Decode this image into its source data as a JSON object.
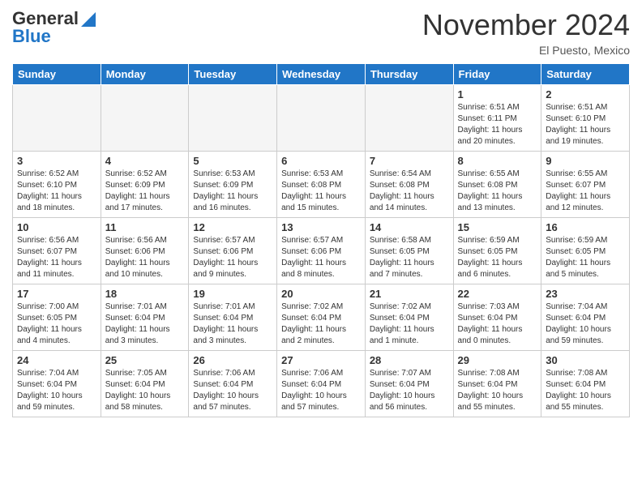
{
  "header": {
    "logo_general": "General",
    "logo_blue": "Blue",
    "month_title": "November 2024",
    "location": "El Puesto, Mexico"
  },
  "weekdays": [
    "Sunday",
    "Monday",
    "Tuesday",
    "Wednesday",
    "Thursday",
    "Friday",
    "Saturday"
  ],
  "rows": [
    [
      {
        "day": "",
        "info": "",
        "empty": true
      },
      {
        "day": "",
        "info": "",
        "empty": true
      },
      {
        "day": "",
        "info": "",
        "empty": true
      },
      {
        "day": "",
        "info": "",
        "empty": true
      },
      {
        "day": "",
        "info": "",
        "empty": true
      },
      {
        "day": "1",
        "info": "Sunrise: 6:51 AM\nSunset: 6:11 PM\nDaylight: 11 hours\nand 20 minutes.",
        "empty": false
      },
      {
        "day": "2",
        "info": "Sunrise: 6:51 AM\nSunset: 6:10 PM\nDaylight: 11 hours\nand 19 minutes.",
        "empty": false
      }
    ],
    [
      {
        "day": "3",
        "info": "Sunrise: 6:52 AM\nSunset: 6:10 PM\nDaylight: 11 hours\nand 18 minutes.",
        "empty": false
      },
      {
        "day": "4",
        "info": "Sunrise: 6:52 AM\nSunset: 6:09 PM\nDaylight: 11 hours\nand 17 minutes.",
        "empty": false
      },
      {
        "day": "5",
        "info": "Sunrise: 6:53 AM\nSunset: 6:09 PM\nDaylight: 11 hours\nand 16 minutes.",
        "empty": false
      },
      {
        "day": "6",
        "info": "Sunrise: 6:53 AM\nSunset: 6:08 PM\nDaylight: 11 hours\nand 15 minutes.",
        "empty": false
      },
      {
        "day": "7",
        "info": "Sunrise: 6:54 AM\nSunset: 6:08 PM\nDaylight: 11 hours\nand 14 minutes.",
        "empty": false
      },
      {
        "day": "8",
        "info": "Sunrise: 6:55 AM\nSunset: 6:08 PM\nDaylight: 11 hours\nand 13 minutes.",
        "empty": false
      },
      {
        "day": "9",
        "info": "Sunrise: 6:55 AM\nSunset: 6:07 PM\nDaylight: 11 hours\nand 12 minutes.",
        "empty": false
      }
    ],
    [
      {
        "day": "10",
        "info": "Sunrise: 6:56 AM\nSunset: 6:07 PM\nDaylight: 11 hours\nand 11 minutes.",
        "empty": false
      },
      {
        "day": "11",
        "info": "Sunrise: 6:56 AM\nSunset: 6:06 PM\nDaylight: 11 hours\nand 10 minutes.",
        "empty": false
      },
      {
        "day": "12",
        "info": "Sunrise: 6:57 AM\nSunset: 6:06 PM\nDaylight: 11 hours\nand 9 minutes.",
        "empty": false
      },
      {
        "day": "13",
        "info": "Sunrise: 6:57 AM\nSunset: 6:06 PM\nDaylight: 11 hours\nand 8 minutes.",
        "empty": false
      },
      {
        "day": "14",
        "info": "Sunrise: 6:58 AM\nSunset: 6:05 PM\nDaylight: 11 hours\nand 7 minutes.",
        "empty": false
      },
      {
        "day": "15",
        "info": "Sunrise: 6:59 AM\nSunset: 6:05 PM\nDaylight: 11 hours\nand 6 minutes.",
        "empty": false
      },
      {
        "day": "16",
        "info": "Sunrise: 6:59 AM\nSunset: 6:05 PM\nDaylight: 11 hours\nand 5 minutes.",
        "empty": false
      }
    ],
    [
      {
        "day": "17",
        "info": "Sunrise: 7:00 AM\nSunset: 6:05 PM\nDaylight: 11 hours\nand 4 minutes.",
        "empty": false
      },
      {
        "day": "18",
        "info": "Sunrise: 7:01 AM\nSunset: 6:04 PM\nDaylight: 11 hours\nand 3 minutes.",
        "empty": false
      },
      {
        "day": "19",
        "info": "Sunrise: 7:01 AM\nSunset: 6:04 PM\nDaylight: 11 hours\nand 3 minutes.",
        "empty": false
      },
      {
        "day": "20",
        "info": "Sunrise: 7:02 AM\nSunset: 6:04 PM\nDaylight: 11 hours\nand 2 minutes.",
        "empty": false
      },
      {
        "day": "21",
        "info": "Sunrise: 7:02 AM\nSunset: 6:04 PM\nDaylight: 11 hours\nand 1 minute.",
        "empty": false
      },
      {
        "day": "22",
        "info": "Sunrise: 7:03 AM\nSunset: 6:04 PM\nDaylight: 11 hours\nand 0 minutes.",
        "empty": false
      },
      {
        "day": "23",
        "info": "Sunrise: 7:04 AM\nSunset: 6:04 PM\nDaylight: 10 hours\nand 59 minutes.",
        "empty": false
      }
    ],
    [
      {
        "day": "24",
        "info": "Sunrise: 7:04 AM\nSunset: 6:04 PM\nDaylight: 10 hours\nand 59 minutes.",
        "empty": false
      },
      {
        "day": "25",
        "info": "Sunrise: 7:05 AM\nSunset: 6:04 PM\nDaylight: 10 hours\nand 58 minutes.",
        "empty": false
      },
      {
        "day": "26",
        "info": "Sunrise: 7:06 AM\nSunset: 6:04 PM\nDaylight: 10 hours\nand 57 minutes.",
        "empty": false
      },
      {
        "day": "27",
        "info": "Sunrise: 7:06 AM\nSunset: 6:04 PM\nDaylight: 10 hours\nand 57 minutes.",
        "empty": false
      },
      {
        "day": "28",
        "info": "Sunrise: 7:07 AM\nSunset: 6:04 PM\nDaylight: 10 hours\nand 56 minutes.",
        "empty": false
      },
      {
        "day": "29",
        "info": "Sunrise: 7:08 AM\nSunset: 6:04 PM\nDaylight: 10 hours\nand 55 minutes.",
        "empty": false
      },
      {
        "day": "30",
        "info": "Sunrise: 7:08 AM\nSunset: 6:04 PM\nDaylight: 10 hours\nand 55 minutes.",
        "empty": false
      }
    ]
  ]
}
